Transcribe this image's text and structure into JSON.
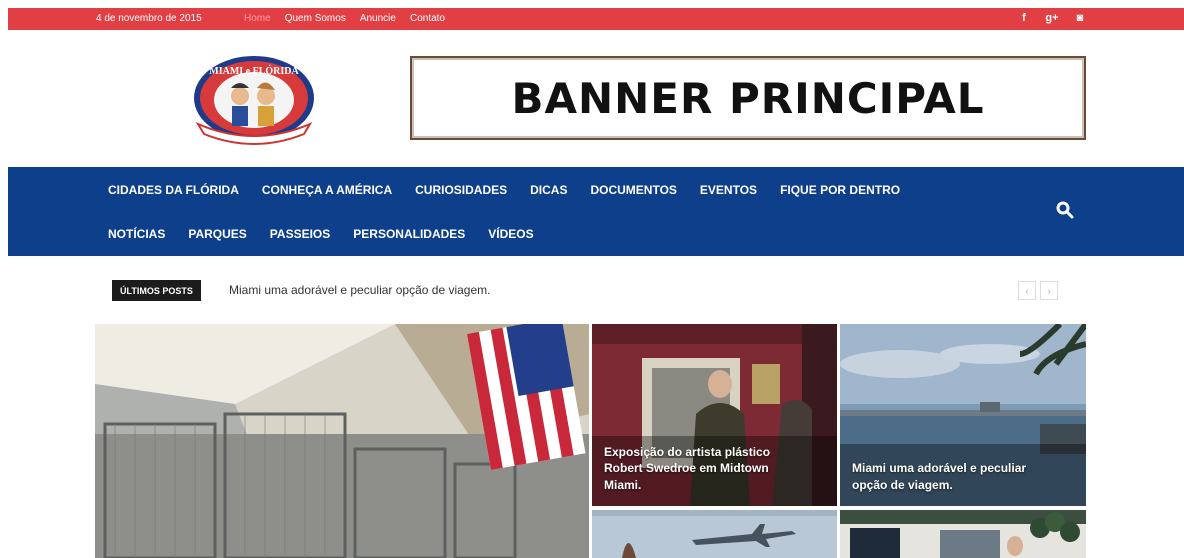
{
  "topbar": {
    "date": "4 de novembro de 2015",
    "nav": [
      {
        "label": "Home",
        "active": true
      },
      {
        "label": "Quem Somos"
      },
      {
        "label": "Anuncie"
      },
      {
        "label": "Contato"
      }
    ],
    "social": [
      {
        "icon": "facebook-icon",
        "glyph": "f"
      },
      {
        "icon": "google-plus-icon",
        "glyph": "g+"
      },
      {
        "icon": "instagram-icon",
        "glyph": "◙"
      }
    ]
  },
  "logo": {
    "text": "MIAMI e FLÓRIDA"
  },
  "banner": {
    "text": "BANNER PRINCIPAL"
  },
  "mainnav": {
    "row1": [
      "CIDADES DA FLÓRIDA",
      "CONHEÇA A AMÉRICA",
      "CURIOSIDADES",
      "DICAS",
      "DOCUMENTOS",
      "EVENTOS",
      "FIQUE POR DENTRO"
    ],
    "row2": [
      "NOTÍCIAS",
      "PARQUES",
      "PASSEIOS",
      "PERSONALIDADES",
      "VÍDEOS"
    ]
  },
  "ticker": {
    "label": "ÚLTIMOS POSTS",
    "text": "Miami uma adorável e peculiar opção de viagem.",
    "prev": "‹",
    "next": "›"
  },
  "featured": {
    "a_caption": "Exposição do artista plástico Robert Swedroe em Midtown Miami.",
    "b_caption": "Miami uma adorável e peculiar opção de viagem."
  },
  "colors": {
    "topbar": "#e23f45",
    "mainnav": "#0d3f8a"
  }
}
